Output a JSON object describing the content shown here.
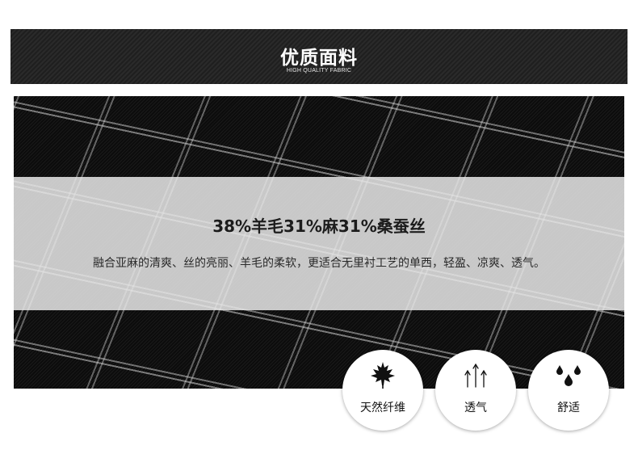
{
  "header": {
    "title": "优质面料",
    "subtitle": "HIGH QUALITY FABRIC"
  },
  "composition": {
    "headline": "38%羊毛31%麻31%桑蚕丝",
    "description": "融合亚麻的清爽、丝的亮丽、羊毛的柔软，更适合无里衬工艺的单西，轻盈、凉爽、透气。"
  },
  "features": [
    {
      "label": "天然纤维",
      "icon": "maple-leaf-icon"
    },
    {
      "label": "透气",
      "icon": "airflow-arrows-icon"
    },
    {
      "label": "舒适",
      "icon": "water-drops-icon"
    }
  ],
  "colors": {
    "header_bg": "#242424",
    "fabric_bg": "#121212",
    "band_bg": "#e8e8e8",
    "text_dark": "#1c1c1c"
  }
}
